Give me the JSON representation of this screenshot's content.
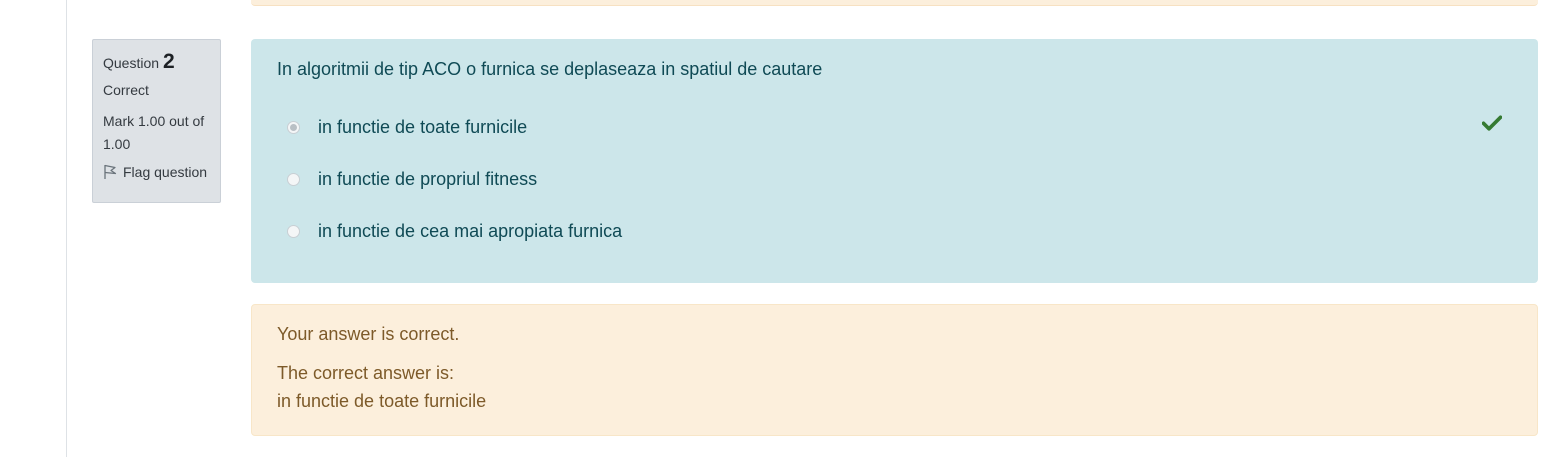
{
  "question": {
    "label": "Question",
    "number": "2",
    "state": "Correct",
    "grade": "Mark 1.00 out of 1.00",
    "flag_label": "Flag question",
    "text": "In algoritmii de tip ACO o furnica se deplaseaza in spatiul de cautare",
    "answers": [
      {
        "label": "in functie de toate furnicile",
        "selected": true,
        "correct": true
      },
      {
        "label": "in functie de propriul fitness",
        "selected": false,
        "correct": false
      },
      {
        "label": "in functie de cea mai apropiata furnica",
        "selected": false,
        "correct": false
      }
    ]
  },
  "feedback": {
    "specific": "Your answer is correct.",
    "right_answer_intro": "The correct answer is:",
    "right_answer_value": "in functie de toate furnicile"
  },
  "colors": {
    "info_bg": "#dee2e6",
    "content_bg": "#cce6ea",
    "feedback_bg": "#fcefdc",
    "check_green": "#357a32"
  },
  "icons": {
    "flag": "flag-icon",
    "correct": "check-icon"
  }
}
